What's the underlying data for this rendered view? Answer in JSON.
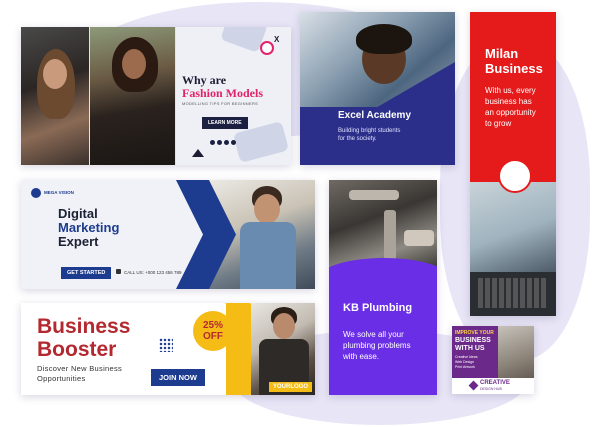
{
  "colors": {
    "blob": "#e8e5f6",
    "fashion_pink": "#e2226a",
    "excel_blue": "#2c2f8a",
    "milan_red": "#e51b1b",
    "marketing_blue": "#1d3c8f",
    "booster_red": "#b3292f",
    "booster_yellow": "#f6bc16",
    "plumbing_purple": "#6a2ee6",
    "creative_purple": "#6b2a8a"
  },
  "fashion": {
    "title_line1": "Why are",
    "title_line2": "Fashion Models",
    "subtitle": "MODELLING TIPS FOR BEGINNERS",
    "button": "LEARN MORE",
    "close_glyph": "X"
  },
  "excel": {
    "title": "Excel Academy",
    "subtitle_line1": "Building bright students",
    "subtitle_line2": "for the society."
  },
  "milan": {
    "title_line1": "Milan",
    "title_line2": "Business",
    "body_line1": "With us, every",
    "body_line2": "business has",
    "body_line3": "an opportunity",
    "body_line4": "to grow"
  },
  "digital": {
    "brand": "MEGA VISION",
    "title_line1": "Digital",
    "title_line2": "Marketing",
    "title_line3": "Expert",
    "button": "GET STARTED",
    "call": "CALL US: +000 123 456 789"
  },
  "booster": {
    "title_line1": "Business",
    "title_line2": "Booster",
    "sub_line1": "Discover New Business",
    "sub_line2": "Opportunities",
    "button": "JOIN NOW",
    "badge_line1": "25%",
    "badge_line2": "OFF",
    "logo": "YOURLOGO"
  },
  "plumbing": {
    "title": "KB Plumbing",
    "body_line1": "We solve all your",
    "body_line2": "plumbing problems",
    "body_line3": "with ease."
  },
  "creative": {
    "line1": "IMPROVE YOUR",
    "line2": "BUSINESS",
    "line3": "WITH US",
    "services": [
      "Creative Ideas",
      "Web Design",
      "Print Artwork"
    ],
    "logo_line1": "CREATIVE",
    "logo_line2": "DESIGN HUB"
  }
}
